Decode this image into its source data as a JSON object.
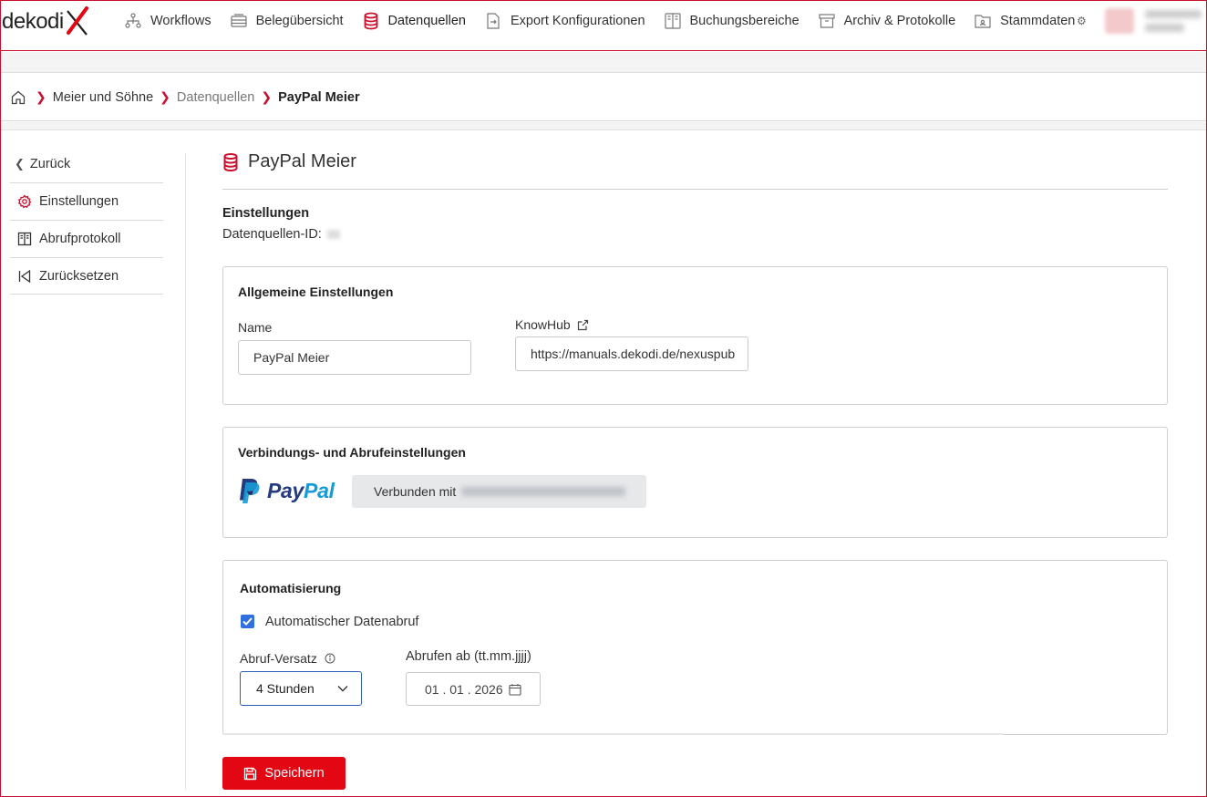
{
  "brand": {
    "logo_text": "dekodi",
    "accent": "#e30613"
  },
  "nav": {
    "items": [
      {
        "label": "Workflows",
        "icon": "workflow-icon"
      },
      {
        "label": "Belegübersicht",
        "icon": "receipts-icon"
      },
      {
        "label": "Datenquellen",
        "icon": "database-icon"
      },
      {
        "label": "Export Konfigurationen",
        "icon": "export-icon"
      },
      {
        "label": "Buchungsbereiche",
        "icon": "columns-icon"
      },
      {
        "label": "Archiv & Protokolle",
        "icon": "archive-icon"
      },
      {
        "label": "Stammdaten",
        "icon": "folder-icon"
      }
    ]
  },
  "breadcrumb": {
    "items": [
      "Meier und Söhne",
      "Datenquellen",
      "PayPal Meier"
    ]
  },
  "sidebar": {
    "back_label": "Zurück",
    "items": [
      {
        "label": "Einstellungen",
        "icon": "gear-icon"
      },
      {
        "label": "Abrufprotokoll",
        "icon": "log-icon"
      },
      {
        "label": "Zurücksetzen",
        "icon": "reset-icon"
      }
    ]
  },
  "page": {
    "title": "PayPal Meier",
    "section_heading": "Einstellungen",
    "datasource_id_label": "Datenquellen-ID:"
  },
  "general": {
    "heading": "Allgemeine Einstellungen",
    "name_label": "Name",
    "name_value": "PayPal Meier",
    "knowhub_label": "KnowHub",
    "knowhub_value": "https://manuals.dekodi.de/nexuspub"
  },
  "connection": {
    "heading": "Verbindungs- und Abrufeinstellungen",
    "provider": "PayPal",
    "provider_pay": "Pay",
    "provider_pal": "Pal",
    "status_label": "Verbunden mit"
  },
  "automation": {
    "heading": "Automatisierung",
    "auto_fetch_label": "Automatischer Datenabruf",
    "auto_fetch_checked": true,
    "interval_label": "Abruf-Versatz",
    "interval_value": "4 Stunden",
    "from_label": "Abrufen ab (tt.mm.jjjj)",
    "from_value": "01 . 01 . 2026"
  },
  "actions": {
    "save_label": "Speichern"
  }
}
